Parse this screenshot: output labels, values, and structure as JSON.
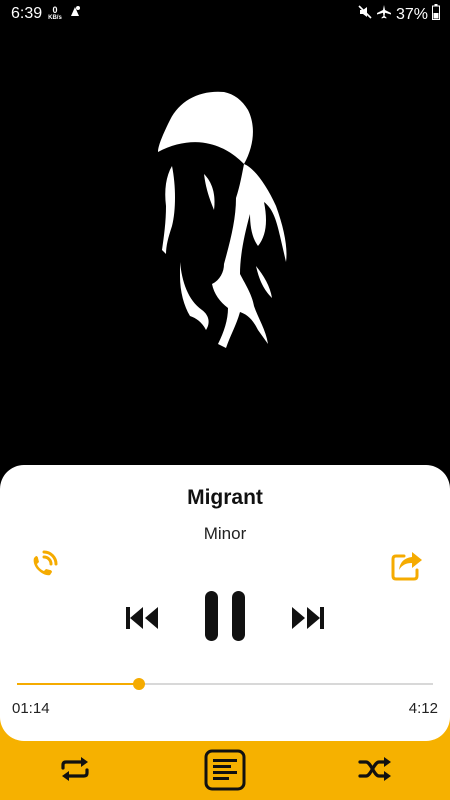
{
  "status_bar": {
    "time": "6:39",
    "data_rate": "0",
    "data_rate_unit": "KB/s",
    "battery": "37%"
  },
  "track": {
    "title": "Migrant",
    "artist": "Minor"
  },
  "playback": {
    "elapsed": "01:14",
    "duration": "4:12",
    "progress_fraction": 0.294
  },
  "colors": {
    "accent": "#f5ab00",
    "bar": "#f6b100"
  },
  "icons": {
    "call": "ringtone-call-icon",
    "share": "share-icon",
    "prev": "previous-icon",
    "pause": "pause-icon",
    "next": "next-icon",
    "repeat": "repeat-icon",
    "lyrics": "lyrics-icon",
    "shuffle": "shuffle-icon"
  }
}
